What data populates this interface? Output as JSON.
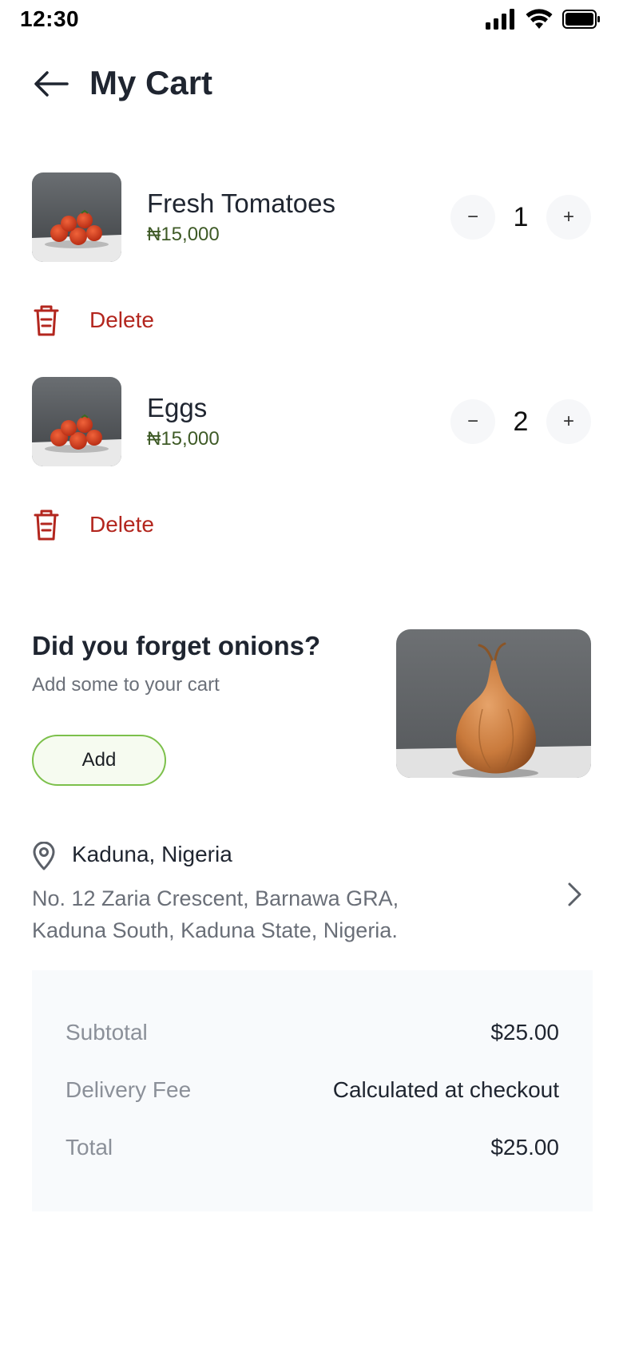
{
  "status_bar": {
    "time": "12:30"
  },
  "header": {
    "title": "My Cart"
  },
  "cart": {
    "items": [
      {
        "name": "Fresh Tomatoes",
        "price": "₦15,000",
        "quantity": "1",
        "decrement": "−",
        "increment": "+",
        "delete_label": "Delete"
      },
      {
        "name": "Eggs",
        "price": "₦15,000",
        "quantity": "2",
        "decrement": "−",
        "increment": "+",
        "delete_label": "Delete"
      }
    ]
  },
  "suggestion": {
    "title": "Did you forget onions?",
    "subtitle": "Add some to your cart",
    "button_label": "Add"
  },
  "address": {
    "city": "Kaduna, Nigeria",
    "line1": "No. 12 Zaria Crescent, Barnawa GRA,",
    "line2": "Kaduna South, Kaduna State, Nigeria."
  },
  "summary": {
    "rows": [
      {
        "label": "Subtotal",
        "value": "$25.00"
      },
      {
        "label": "Delivery Fee",
        "value": "Calculated at checkout"
      },
      {
        "label": "Total",
        "value": "$25.00"
      }
    ]
  },
  "colors": {
    "delete": "#b3261e",
    "price": "#3e5a26",
    "accent_border": "#7cc04b",
    "summary_bg": "#f8fafc"
  }
}
